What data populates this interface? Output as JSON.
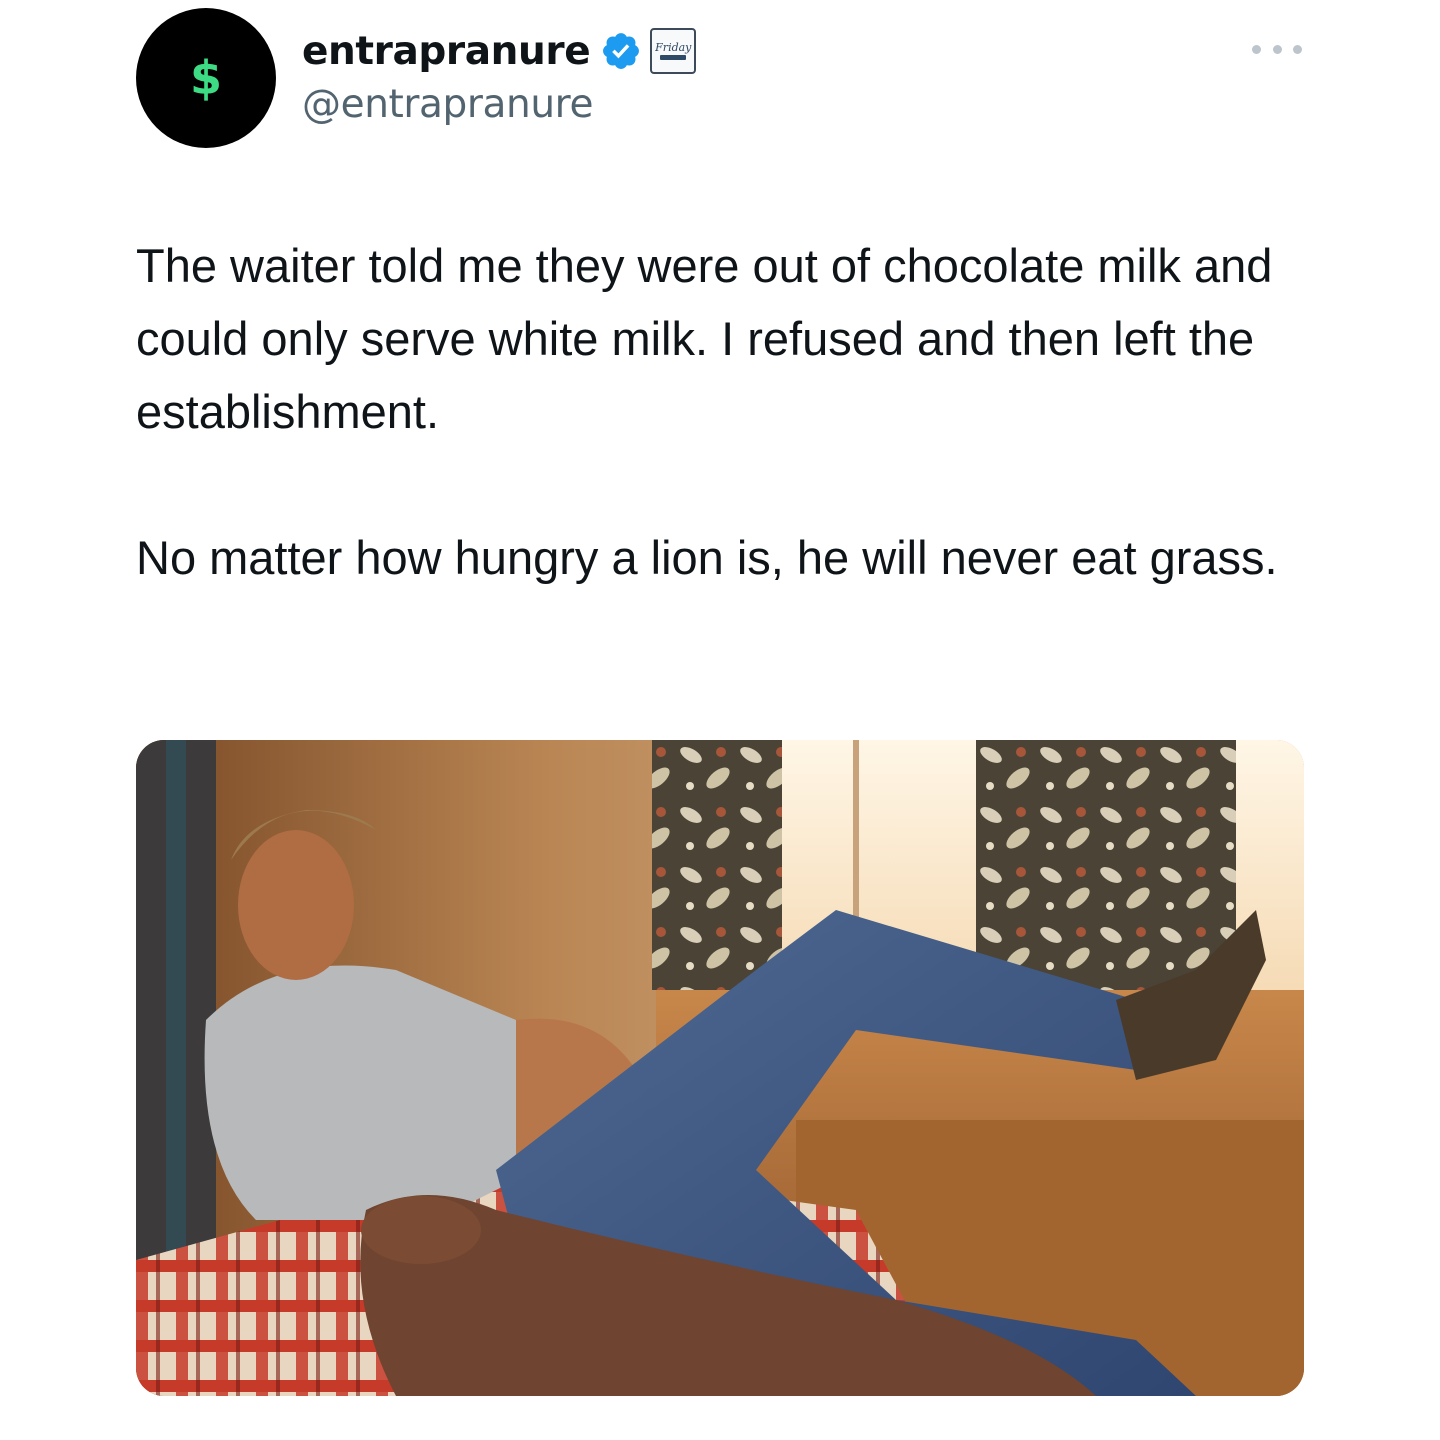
{
  "tweet": {
    "author": {
      "avatar_glyph": "$",
      "avatar_bg": "#000000",
      "avatar_glyph_color": "#3ddc84",
      "display_name": "entrapranure",
      "handle": "@entrapranure",
      "verified_icon": "verified-badge-icon",
      "verified_color": "#1d9bf0",
      "affiliate_badge_label": "Friday"
    },
    "more_icon": "more-options-icon",
    "text": "The waiter told me they were out of chocolate milk and could only serve white milk. I refused and then left the establishment.\n\nNo matter how hungry a lion is, he will never eat grass.",
    "media": {
      "kind": "photo",
      "description_icon": "photo-image"
    }
  }
}
